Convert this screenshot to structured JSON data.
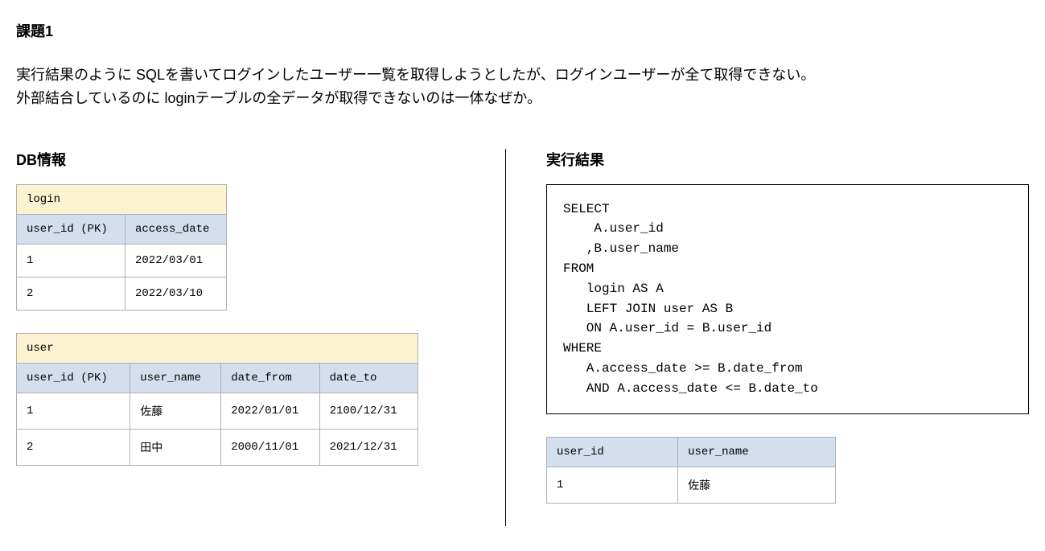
{
  "title": "課題1",
  "question_line1": "実行結果のように SQLを書いてログインしたユーザー一覧を取得しようとしたが、ログインユーザーが全て取得できない。",
  "question_line2": "外部結合しているのに loginテーブルの全データが取得できないのは一体なぜか。",
  "left": {
    "heading": "DB情報",
    "login": {
      "name": "login",
      "columns": [
        "user_id (PK)",
        "access_date"
      ],
      "rows": [
        [
          "1",
          "2022/03/01"
        ],
        [
          "2",
          "2022/03/10"
        ]
      ]
    },
    "user": {
      "name": "user",
      "columns": [
        "user_id (PK)",
        "user_name",
        "date_from",
        "date_to"
      ],
      "rows": [
        [
          "1",
          "佐藤",
          "2022/01/01",
          "2100/12/31"
        ],
        [
          "2",
          "田中",
          "2000/11/01",
          "2021/12/31"
        ]
      ]
    }
  },
  "right": {
    "heading": "実行結果",
    "sql": "SELECT\n    A.user_id\n   ,B.user_name\nFROM\n   login AS A\n   LEFT JOIN user AS B\n   ON A.user_id = B.user_id\nWHERE\n   A.access_date >= B.date_from\n   AND A.access_date <= B.date_to",
    "result": {
      "columns": [
        "user_id",
        "user_name"
      ],
      "rows": [
        [
          "1",
          "佐藤"
        ]
      ]
    }
  }
}
